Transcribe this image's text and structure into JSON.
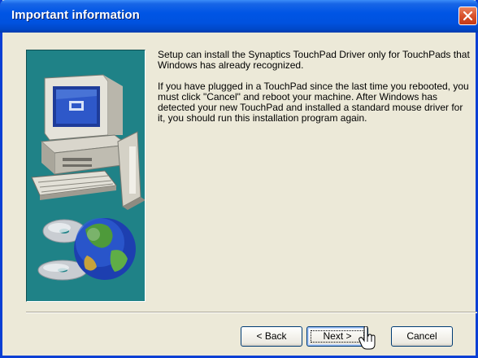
{
  "window": {
    "title": "Important information"
  },
  "content": {
    "paragraph1": "Setup can install the Synaptics TouchPad Driver only for TouchPads that Windows has already recognized.",
    "paragraph2": "If you have plugged in a TouchPad since the last time you rebooted, you must click \"Cancel\" and reboot your machine. After Windows has detected your new TouchPad and installed a standard mouse driver for it, you should run this installation program again."
  },
  "buttons": {
    "back": "< Back",
    "next": "Next >",
    "cancel": "Cancel"
  },
  "icons": {
    "close": "close-icon",
    "cursor": "hand-pointer-icon"
  },
  "colors": {
    "titlebar": "#0055E5",
    "art_background": "#1F8287",
    "close_button": "#D9512B"
  }
}
